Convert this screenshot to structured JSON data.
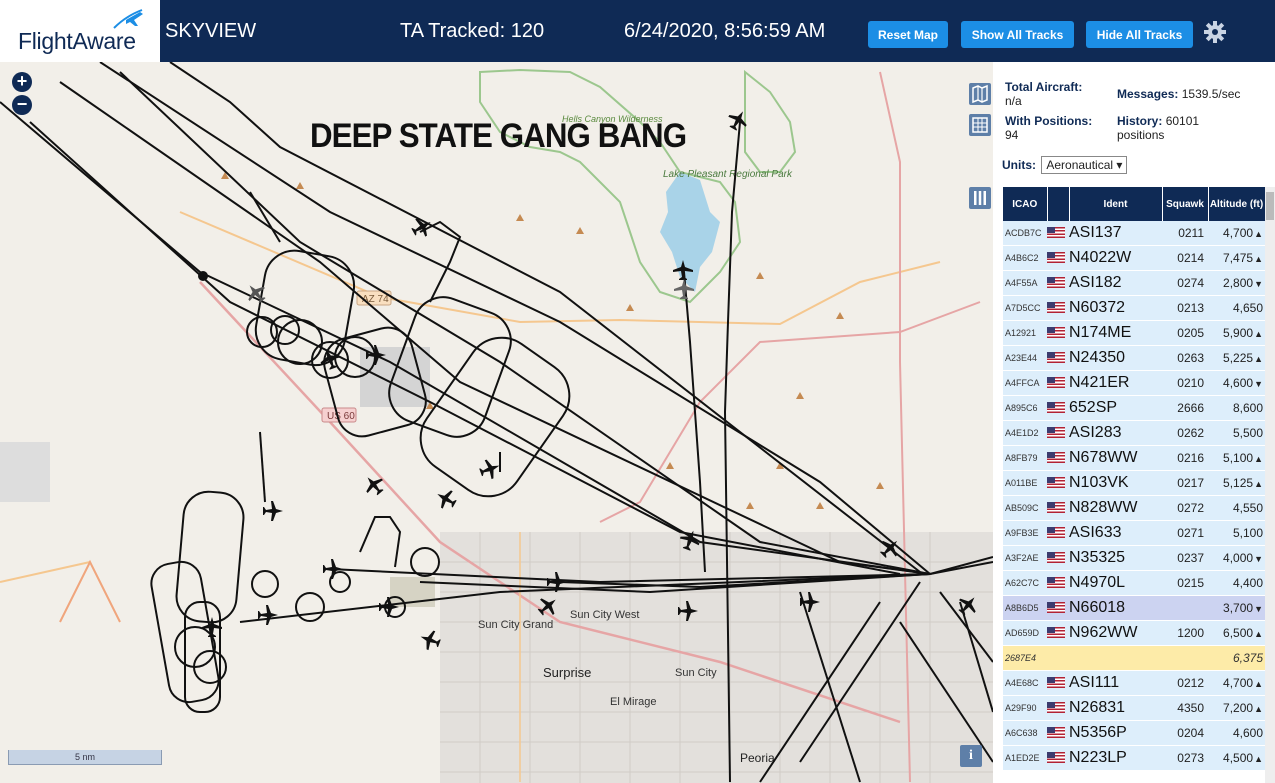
{
  "header": {
    "logo_text": "FlightAware",
    "app_title": "SKYVIEW",
    "ta_tracked": "TA Tracked: 120",
    "timestamp": "6/24/2020, 8:56:59 AM",
    "buttons": {
      "reset": "Reset Map",
      "show_all": "Show All Tracks",
      "hide_all": "Hide All Tracks"
    }
  },
  "map": {
    "overlay_caption": "DEEP STATE GANG BANG",
    "scale_label": "5 nm",
    "zoom_in": "+",
    "zoom_out": "−",
    "info": "i",
    "place_labels": {
      "hells_canyon": "Hells Canyon Wilderness",
      "lake_pleasant": "Lake Pleasant Regional Park",
      "sun_city_grand": "Sun City Grand",
      "sun_city_west": "Sun City West",
      "surprise": "Surprise",
      "sun_city": "Sun City",
      "el_mirage": "El Mirage",
      "peoria": "Peoria"
    },
    "road_labels": {
      "az74": "AZ 74",
      "us60": "US 60"
    }
  },
  "sidebar": {
    "total_aircraft_label": "Total Aircraft:",
    "total_aircraft_value": "n/a",
    "messages_label": "Messages:",
    "messages_value": "1539.5/sec",
    "with_positions_label": "With Positions:",
    "with_positions_value": "94",
    "history_label": "History:",
    "history_value": "60101",
    "history_unit": "positions",
    "units_label": "Units:",
    "units_value": "Aeronautical",
    "table_headers": {
      "icao": "ICAO",
      "ident": "Ident",
      "squawk": "Squawk",
      "altitude": "Altitude (ft)"
    },
    "rows": [
      {
        "icao": "ACDB7C",
        "ident": "ASI137",
        "squawk": "0211",
        "alt": "4,700",
        "trend": "up",
        "flag": true
      },
      {
        "icao": "A4B6C2",
        "ident": "N4022W",
        "squawk": "0214",
        "alt": "7,475",
        "trend": "up",
        "flag": true
      },
      {
        "icao": "A4F55A",
        "ident": "ASI182",
        "squawk": "0274",
        "alt": "2,800",
        "trend": "down",
        "flag": true
      },
      {
        "icao": "A7D5CC",
        "ident": "N60372",
        "squawk": "0213",
        "alt": "4,650",
        "trend": "",
        "flag": true
      },
      {
        "icao": "A12921",
        "ident": "N174ME",
        "squawk": "0205",
        "alt": "5,900",
        "trend": "up",
        "flag": true
      },
      {
        "icao": "A23E44",
        "ident": "N24350",
        "squawk": "0263",
        "alt": "5,225",
        "trend": "up",
        "flag": true
      },
      {
        "icao": "A4FFCA",
        "ident": "N421ER",
        "squawk": "0210",
        "alt": "4,600",
        "trend": "down",
        "flag": true
      },
      {
        "icao": "A895C6",
        "ident": "652SP",
        "squawk": "2666",
        "alt": "8,600",
        "trend": "",
        "flag": true
      },
      {
        "icao": "A4E1D2",
        "ident": "ASI283",
        "squawk": "0262",
        "alt": "5,500",
        "trend": "",
        "flag": true
      },
      {
        "icao": "A8FB79",
        "ident": "N678WW",
        "squawk": "0216",
        "alt": "5,100",
        "trend": "up",
        "flag": true
      },
      {
        "icao": "A011BE",
        "ident": "N103VK",
        "squawk": "0217",
        "alt": "5,125",
        "trend": "up",
        "flag": true
      },
      {
        "icao": "AB509C",
        "ident": "N828WW",
        "squawk": "0272",
        "alt": "4,550",
        "trend": "",
        "flag": true
      },
      {
        "icao": "A9FB3E",
        "ident": "ASI633",
        "squawk": "0271",
        "alt": "5,100",
        "trend": "",
        "flag": true
      },
      {
        "icao": "A3F2AE",
        "ident": "N35325",
        "squawk": "0237",
        "alt": "4,000",
        "trend": "down",
        "flag": true
      },
      {
        "icao": "A62C7C",
        "ident": "N4970L",
        "squawk": "0215",
        "alt": "4,400",
        "trend": "",
        "flag": true
      },
      {
        "icao": "A8B6D5",
        "ident": "N66018",
        "squawk": "",
        "alt": "3,700",
        "trend": "down",
        "flag": true,
        "selected": true
      },
      {
        "icao": "AD659D",
        "ident": "N962WW",
        "squawk": "1200",
        "alt": "6,500",
        "trend": "up",
        "flag": true
      },
      {
        "icao": "2687E4",
        "ident": "",
        "squawk": "",
        "alt": "6,375",
        "trend": "",
        "flag": false,
        "mlat": true
      },
      {
        "icao": "A4E68C",
        "ident": "ASI111",
        "squawk": "0212",
        "alt": "4,700",
        "trend": "up",
        "flag": true
      },
      {
        "icao": "A29F90",
        "ident": "N26831",
        "squawk": "4350",
        "alt": "7,200",
        "trend": "up",
        "flag": true
      },
      {
        "icao": "A6C638",
        "ident": "N5356P",
        "squawk": "0204",
        "alt": "4,600",
        "trend": "",
        "flag": true
      },
      {
        "icao": "A1ED2E",
        "ident": "N223LP",
        "squawk": "0273",
        "alt": "4,500",
        "trend": "up",
        "flag": true
      }
    ]
  },
  "colors": {
    "header_bg": "#0f2a55",
    "button_bg": "#1c8ee5",
    "row_bg": "#ddeefb",
    "selected_row": "#ccd3f1",
    "mlat_row": "#fdeba8"
  }
}
